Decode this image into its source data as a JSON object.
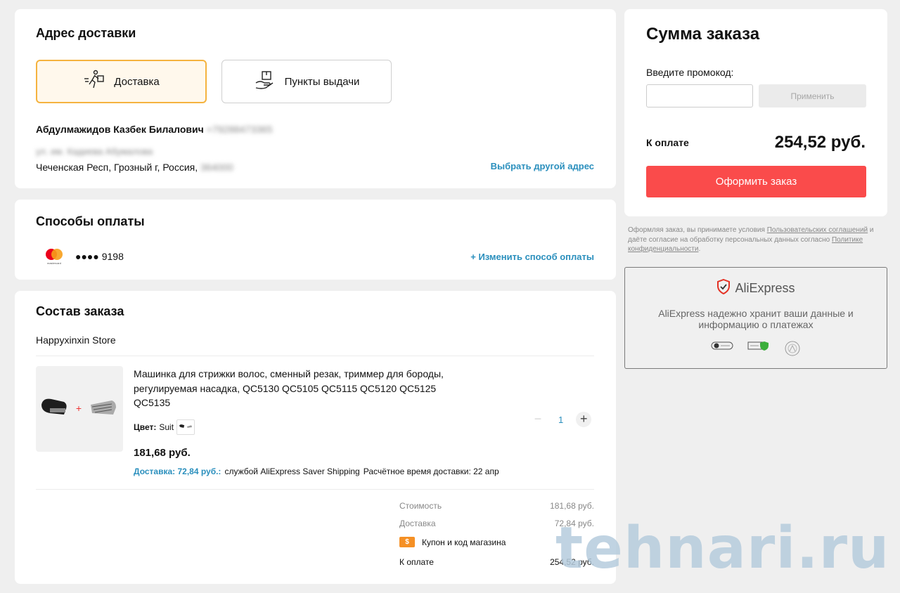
{
  "address": {
    "title": "Адрес доставки",
    "delivery_label": "Доставка",
    "pickup_label": "Пункты выдачи",
    "recipient_name": "Абдулмажидов Казбек Билалович",
    "phone_hidden": "+79288473365",
    "street_hidden": "ул. им. Кадиева Абумалова",
    "city_line": "Чеченская Респ, Грозный г, Россия,",
    "zip_hidden": "364000",
    "change_link": "Выбрать другой адрес"
  },
  "payment": {
    "title": "Способы оплаты",
    "card_brand": "mastercard",
    "card_number": "●●●● 9198",
    "change_link": "+ Изменить способ оплаты"
  },
  "order": {
    "title": "Состав заказа",
    "store": "Happyxinxin Store",
    "product_title": "Машинка для стрижки волос, сменный резак, триммер для бороды, регулируемая насадка, QC5130 QC5105 QC5115 QC5120 QC5125 QC5135",
    "color_label": "Цвет:",
    "color_value": "Suit",
    "price": "181,68 руб.",
    "shipping_price": "Доставка: 72,84 руб.:",
    "shipping_service": "службой AliExpress Saver Shipping",
    "shipping_eta": "Расчётное время доставки: 22 апр",
    "quantity": "1",
    "totals": {
      "cost_label": "Стоимость",
      "cost_value": "181,68 руб.",
      "delivery_label": "Доставка",
      "delivery_value": "72,84 руб.",
      "coupon_label": "Купон и код магазина",
      "pay_label": "К оплате",
      "pay_value": "254,52 руб."
    }
  },
  "summary": {
    "title": "Сумма заказа",
    "promo_label": "Введите промокод:",
    "promo_value": "",
    "apply_label": "Применить",
    "pay_label": "К оплате",
    "pay_total": "254,52 руб.",
    "checkout_label": "Оформить заказ"
  },
  "terms": {
    "part1": "Оформляя заказ, вы принимаете условия ",
    "link1": "Пользовательских соглашений",
    "part2": " и даёте согласие на обработку персональных данных согласно ",
    "link2": "Политике конфиденциальности",
    "part3": "."
  },
  "security": {
    "brand": "AliExpress",
    "text": "AliExpress надежно хранит ваши данные и информацию о платежах"
  },
  "watermark": "tehnari.ru",
  "colors": {
    "accent_red": "#fa4b4b",
    "link_blue": "#2a8fbd",
    "selected_border": "#f5b33f"
  }
}
